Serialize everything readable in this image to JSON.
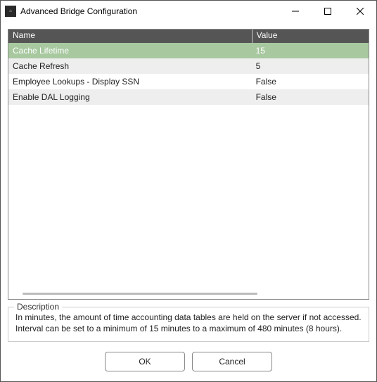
{
  "window": {
    "title": "Advanced Bridge Configuration",
    "app_icon_text": "⌂"
  },
  "grid": {
    "headers": {
      "name": "Name",
      "value": "Value"
    },
    "rows": [
      {
        "name": "Cache Lifetime",
        "value": "15",
        "selected": true
      },
      {
        "name": "Cache Refresh",
        "value": "5",
        "selected": false
      },
      {
        "name": "Employee Lookups - Display SSN",
        "value": "False",
        "selected": false
      },
      {
        "name": "Enable DAL Logging",
        "value": "False",
        "selected": false
      }
    ]
  },
  "description": {
    "label": "Description",
    "text": "In minutes, the amount of time accounting data tables are held on the server if not accessed. Interval can be set to a minimum of 15 minutes to a maximum of 480 minutes (8 hours)."
  },
  "buttons": {
    "ok": "OK",
    "cancel": "Cancel"
  }
}
